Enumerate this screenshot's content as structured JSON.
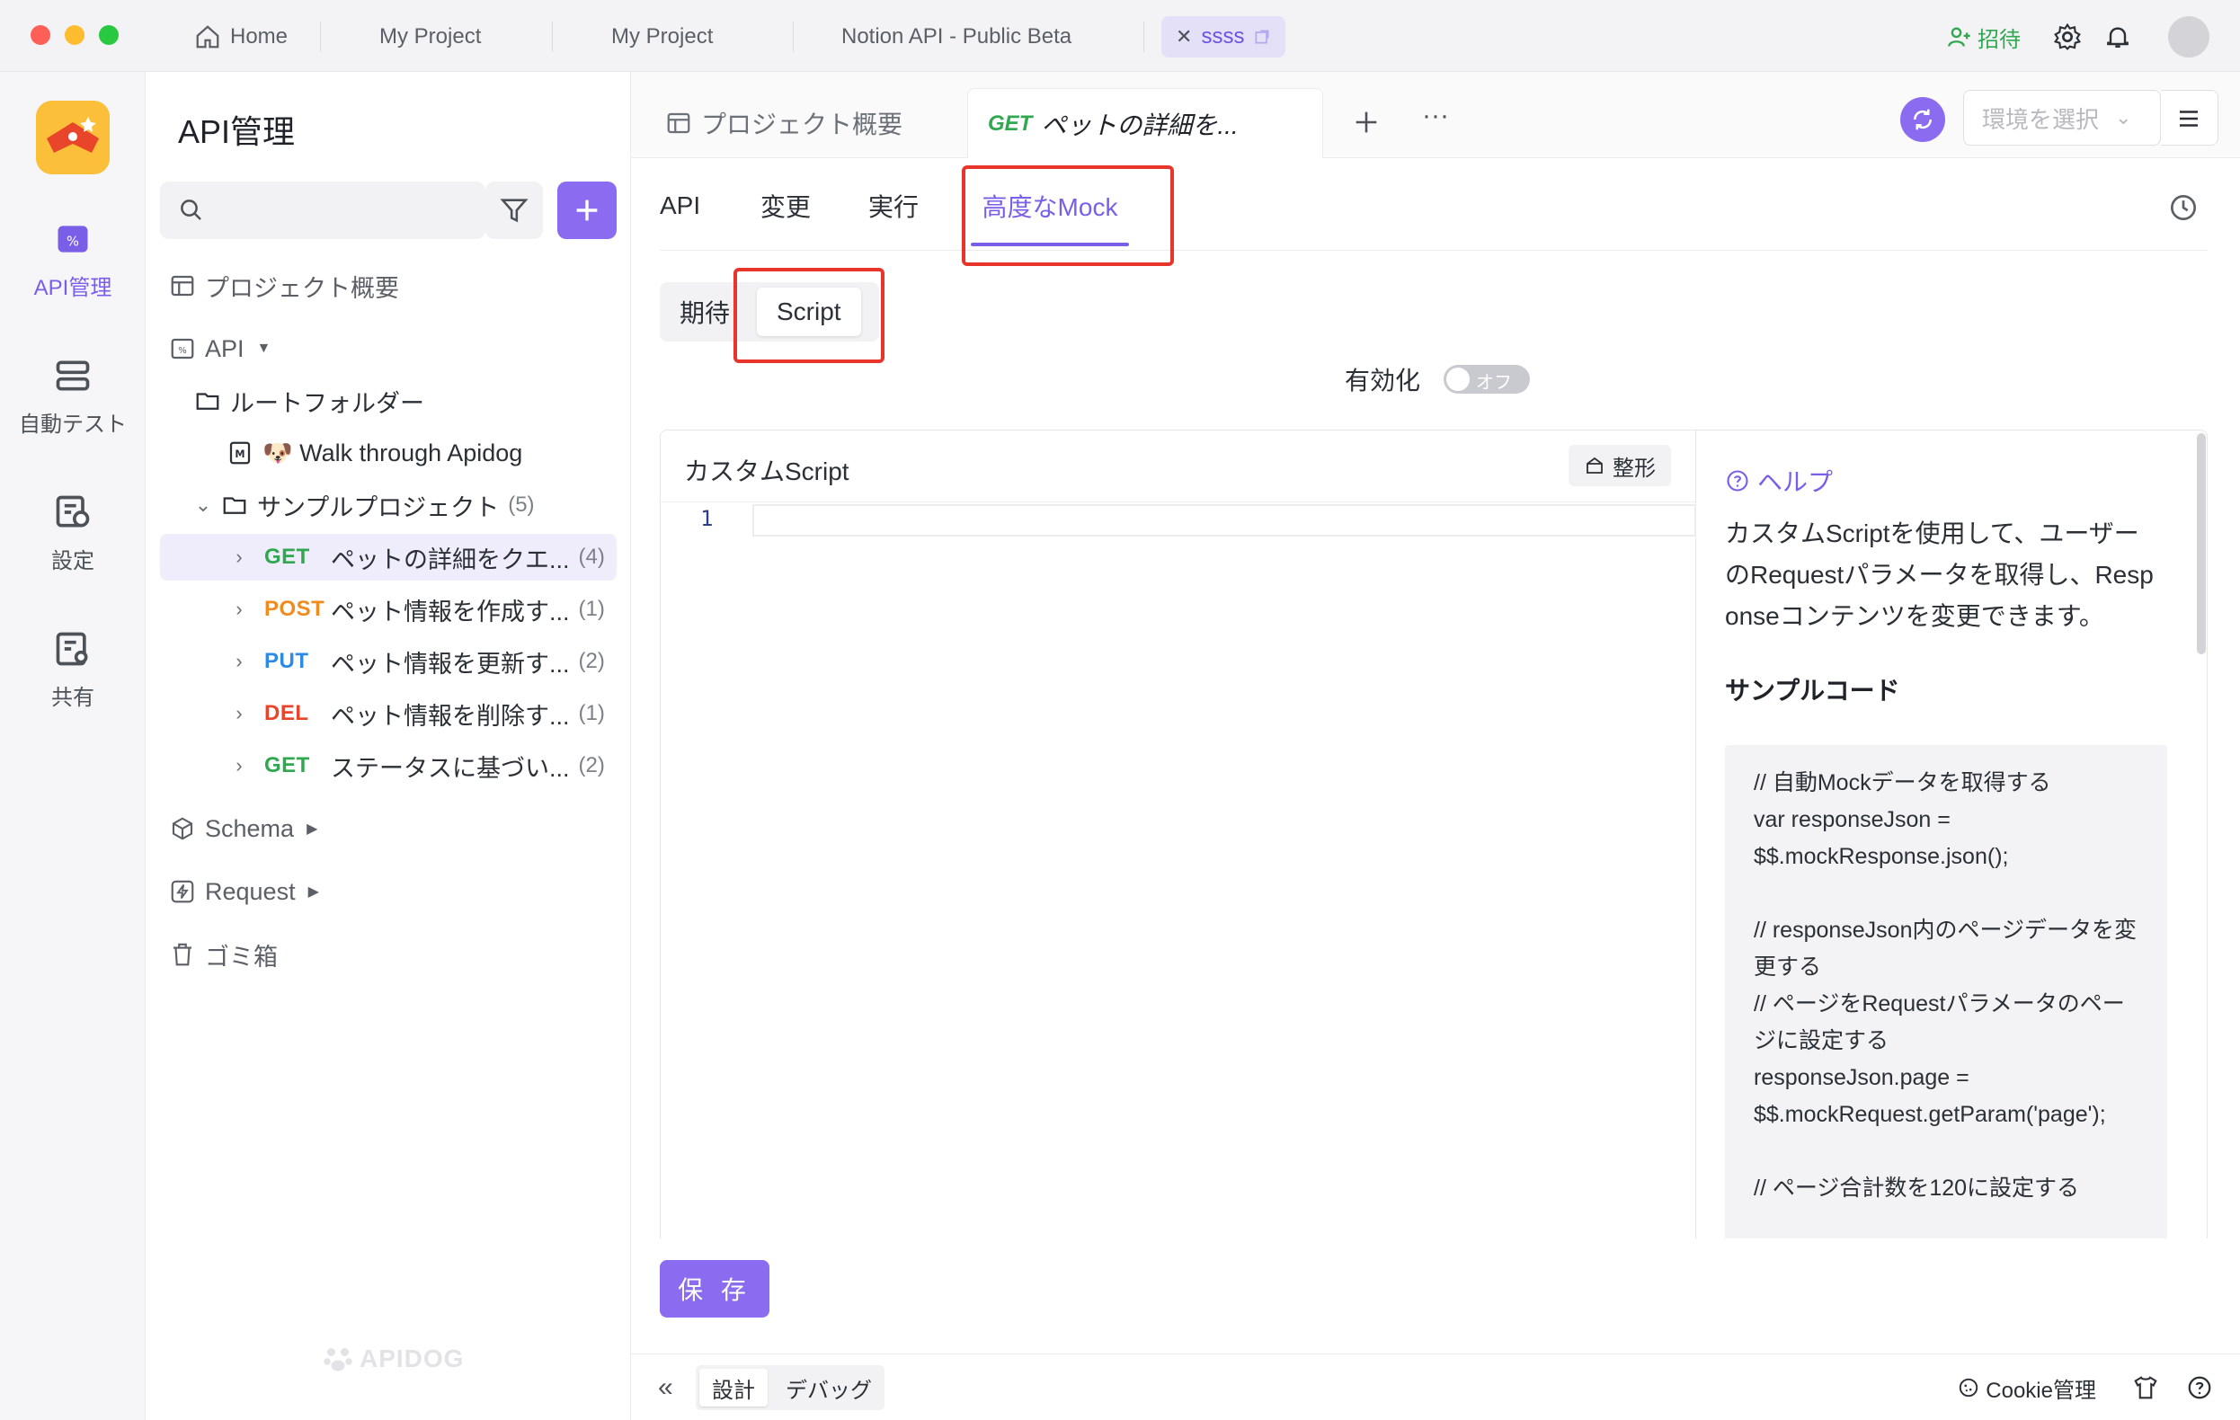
{
  "titlebar": {
    "tabs": [
      {
        "label": "Home",
        "icon": "home-icon"
      },
      {
        "label": "My Project"
      },
      {
        "label": "My Project"
      },
      {
        "label": "Notion API - Public Beta"
      },
      {
        "label": "ssss",
        "active": true
      }
    ],
    "invite_label": "招待"
  },
  "rail": {
    "items": [
      {
        "label": "API管理",
        "icon": "api-icon",
        "active": true
      },
      {
        "label": "自動テスト",
        "icon": "test-icon"
      },
      {
        "label": "設定",
        "icon": "settings-icon"
      },
      {
        "label": "共有",
        "icon": "share-icon"
      }
    ]
  },
  "sidebar": {
    "title": "API管理",
    "search_placeholder": "",
    "project_overview": "プロジェクト概要",
    "api_label": "API",
    "root_folder": "ルートフォルダー",
    "walkthrough": "🐶 Walk through Apidog",
    "sample_project": "サンプルプロジェクト",
    "sample_count": "(5)",
    "endpoints": [
      {
        "method": "GET",
        "label": "ペットの詳細をクエ...",
        "count": "(4)",
        "color": "#2fa84f",
        "selected": true
      },
      {
        "method": "POST",
        "label": "ペット情報を作成す...",
        "count": "(1)",
        "color": "#f08c1e"
      },
      {
        "method": "PUT",
        "label": "ペット情報を更新す...",
        "count": "(2)",
        "color": "#2d8ae6"
      },
      {
        "method": "DEL",
        "label": "ペット情報を削除す...",
        "count": "(1)",
        "color": "#e8452b"
      },
      {
        "method": "GET",
        "label": "ステータスに基づい...",
        "count": "(2)",
        "color": "#2fa84f"
      }
    ],
    "schema": "Schema",
    "request": "Request",
    "trash": "ゴミ箱",
    "watermark": "APIDOG"
  },
  "main": {
    "doc_tabs": {
      "overview": "プロジェクト概要",
      "active_method": "GET",
      "active_label": "ペットの詳細を..."
    },
    "env_placeholder": "環境を選択",
    "sub_tabs": [
      "API",
      "変更",
      "実行",
      "高度なMock"
    ],
    "segments": [
      "期待",
      "Script"
    ],
    "enable_label": "有効化",
    "toggle_label": "オフ",
    "editor": {
      "title": "カスタムScript",
      "format_label": "整形",
      "line_number": "1"
    },
    "help": {
      "link": "ヘルプ",
      "text": "カスタムScriptを使用して、ユーザーのRequestパラメータを取得し、Responseコンテンツを変更できます。",
      "sample_heading": "サンプルコード",
      "code": "// 自動Mockデータを取得する\nvar responseJson =\n$$.mockResponse.json();\n\n// responseJson内のページデータを変更する\n// ページをRequestパラメータのページに設定する\nresponseJson.page =\n$$.mockRequest.getParam('page');\n\n// ページ合計数を120に設定する"
    },
    "save_label": "保 存",
    "footer": {
      "design": "設計",
      "debug": "デバッグ",
      "cookie": "Cookie管理"
    }
  },
  "colors": {
    "accent": "#8b6cf0",
    "highlight": "#e8352b"
  }
}
